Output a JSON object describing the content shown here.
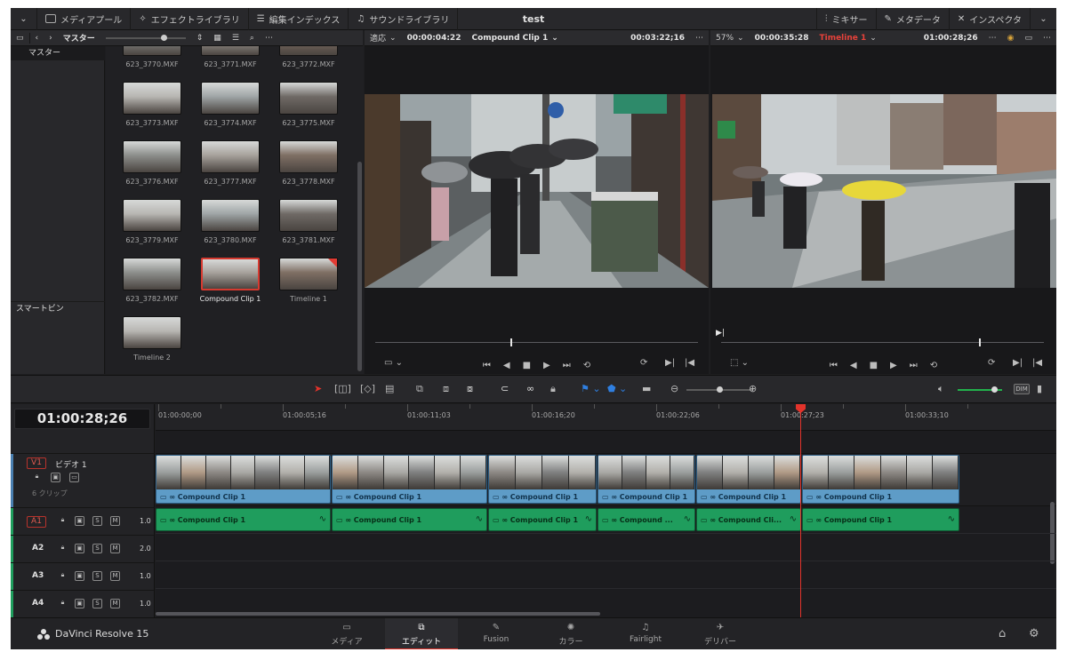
{
  "topbar": {
    "project_title": "test",
    "left_buttons": [
      "メディアプール",
      "エフェクトライブラリ",
      "編集インデックス",
      "サウンドライブラリ"
    ],
    "right_buttons": [
      "ミキサー",
      "メタデータ",
      "インスペクタ"
    ]
  },
  "media_bar": {
    "folder": "マスター"
  },
  "source_bar": {
    "fit": "適応",
    "timecode_left": "00:00:04:22",
    "clip_name": "Compound Clip 1",
    "timecode_right": "00:03:22;16"
  },
  "timeline_bar": {
    "zoom": "57%",
    "timecode_left": "00:00:35:28",
    "timeline_name": "Timeline 1",
    "timecode_right": "01:00:28;26"
  },
  "left_panel": {
    "master": "マスター",
    "smart_bins": "スマートビン"
  },
  "media_pool": {
    "clips": [
      {
        "label": "623_3770.MXF"
      },
      {
        "label": "623_3771.MXF"
      },
      {
        "label": "623_3772.MXF"
      },
      {
        "label": "623_3773.MXF"
      },
      {
        "label": "623_3774.MXF"
      },
      {
        "label": "623_3775.MXF"
      },
      {
        "label": "623_3776.MXF"
      },
      {
        "label": "623_3777.MXF"
      },
      {
        "label": "623_3778.MXF"
      },
      {
        "label": "623_3779.MXF"
      },
      {
        "label": "623_3780.MXF"
      },
      {
        "label": "623_3781.MXF"
      },
      {
        "label": "623_3782.MXF"
      },
      {
        "label": "Compound Clip 1"
      },
      {
        "label": "Timeline 1"
      },
      {
        "label": "Timeline 2"
      }
    ]
  },
  "timeline": {
    "timecode": "01:00:28;26",
    "ruler": [
      "01:00:00;00",
      "01:00:05;16",
      "01:00:11;03",
      "01:00:16;20",
      "01:00:22;06",
      "01:00:27;23",
      "01:00:33;10"
    ],
    "video_track": {
      "id": "V1",
      "name": "ビデオ 1",
      "clip_count": "6 クリップ"
    },
    "audio_tracks": [
      {
        "id": "A1",
        "volume": "1.0",
        "s": "S",
        "m": "M"
      },
      {
        "id": "A2",
        "volume": "2.0",
        "s": "S",
        "m": "M"
      },
      {
        "id": "A3",
        "volume": "1.0",
        "s": "S",
        "m": "M"
      },
      {
        "id": "A4",
        "volume": "1.0",
        "s": "S",
        "m": "M"
      }
    ],
    "video_clips": [
      "Compound Clip 1",
      "Compound Clip 1",
      "Compound Clip 1",
      "Compound Clip 1",
      "Compound Clip 1",
      "Compound Clip 1"
    ],
    "audio_clips": [
      "Compound Clip 1",
      "Compound Clip 1",
      "Compound Clip 1",
      "Compound ...",
      "Compound Cli...",
      "Compound Clip 1"
    ]
  },
  "toolbar": {
    "dim": "DIM"
  },
  "bottom": {
    "app_name": "DaVinci Resolve 15",
    "pages": [
      "メディア",
      "エディット",
      "Fusion",
      "カラー",
      "Fairlight",
      "デリバー"
    ],
    "active_page": "エディット"
  },
  "colors": {
    "accent_red": "#e3332b",
    "video_clip": "#5e9cc7",
    "audio_clip": "#1f9d5d",
    "audio_meter": "#22b24c"
  }
}
